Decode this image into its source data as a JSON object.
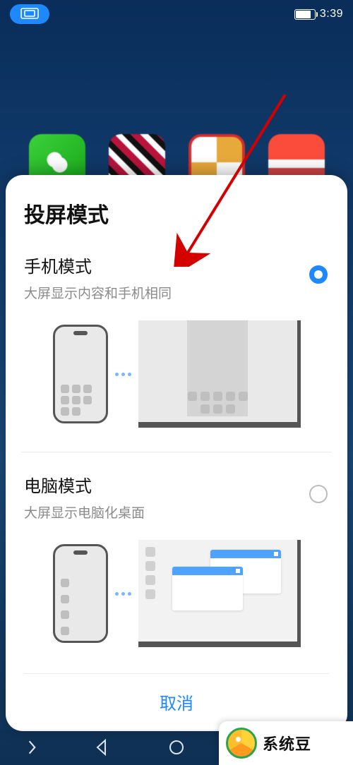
{
  "status": {
    "time": "3:39"
  },
  "dialog": {
    "title": "投屏模式",
    "options": [
      {
        "title": "手机模式",
        "desc": "大屏显示内容和手机相同",
        "selected": true
      },
      {
        "title": "电脑模式",
        "desc": "大屏显示电脑化桌面",
        "selected": false
      }
    ],
    "cancel": "取消"
  },
  "watermark": {
    "text": "系统豆"
  }
}
